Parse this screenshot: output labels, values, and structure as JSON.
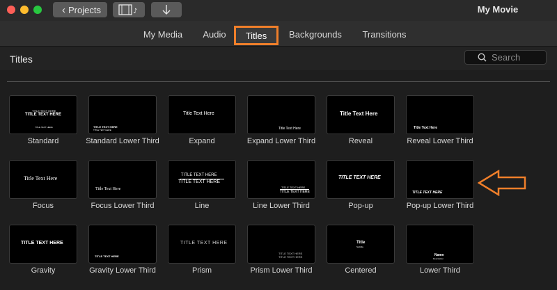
{
  "titlebar": {
    "projects_label": "Projects",
    "window_title": "My Movie"
  },
  "tabs": [
    {
      "label": "My Media"
    },
    {
      "label": "Audio"
    },
    {
      "label": "Titles",
      "selected": true
    },
    {
      "label": "Backgrounds"
    },
    {
      "label": "Transitions"
    }
  ],
  "header": {
    "title": "Titles",
    "search_placeholder": "Search"
  },
  "tiles": [
    {
      "label": "Standard",
      "t1": "TITLE TEXT HERE",
      "t0": "TITLE TEXT HERE",
      "t2": "TITLE TEXT HERE"
    },
    {
      "label": "Standard Lower Third",
      "t1": "TITLE TEXT HERE",
      "t2": "TITLE TEXT HERE"
    },
    {
      "label": "Expand",
      "t1": "Title Text Here"
    },
    {
      "label": "Expand Lower Third",
      "t1": "Title Text Here"
    },
    {
      "label": "Reveal",
      "t1": "Title Text Here"
    },
    {
      "label": "Reveal Lower Third",
      "t1": "Title Text Here"
    },
    {
      "label": "Focus",
      "t1": "Title Text Here"
    },
    {
      "label": "Focus Lower Third",
      "t1": "Title Text Here"
    },
    {
      "label": "Line",
      "t1": "TITLE TEXT HERE",
      "t2": "TITLE TEXT HERE"
    },
    {
      "label": "Line Lower Third",
      "t1": "TITLE TEXT HERE",
      "t2": "TITLE TEXT HERE"
    },
    {
      "label": "Pop-up",
      "t1": "TITLE TEXT HERE"
    },
    {
      "label": "Pop-up Lower Third",
      "t1": "TITLE TEXT HERE"
    },
    {
      "label": "Gravity",
      "t1": "TITLE TEXT HERE"
    },
    {
      "label": "Gravity Lower Third",
      "t1": "TITLE TEXT HERE"
    },
    {
      "label": "Prism",
      "t1": "TITLE TEXT HERE"
    },
    {
      "label": "Prism Lower Third",
      "t1": "TITLE TEXT HERE",
      "t2": "TITLE TEXT HERE"
    },
    {
      "label": "Centered",
      "t1": "Title",
      "t2": "Subtitle"
    },
    {
      "label": "Lower Third",
      "t1": "Name",
      "t2": "Description"
    }
  ],
  "colors": {
    "accent_orange": "#f07f2a",
    "background": "#1e1e1e"
  }
}
